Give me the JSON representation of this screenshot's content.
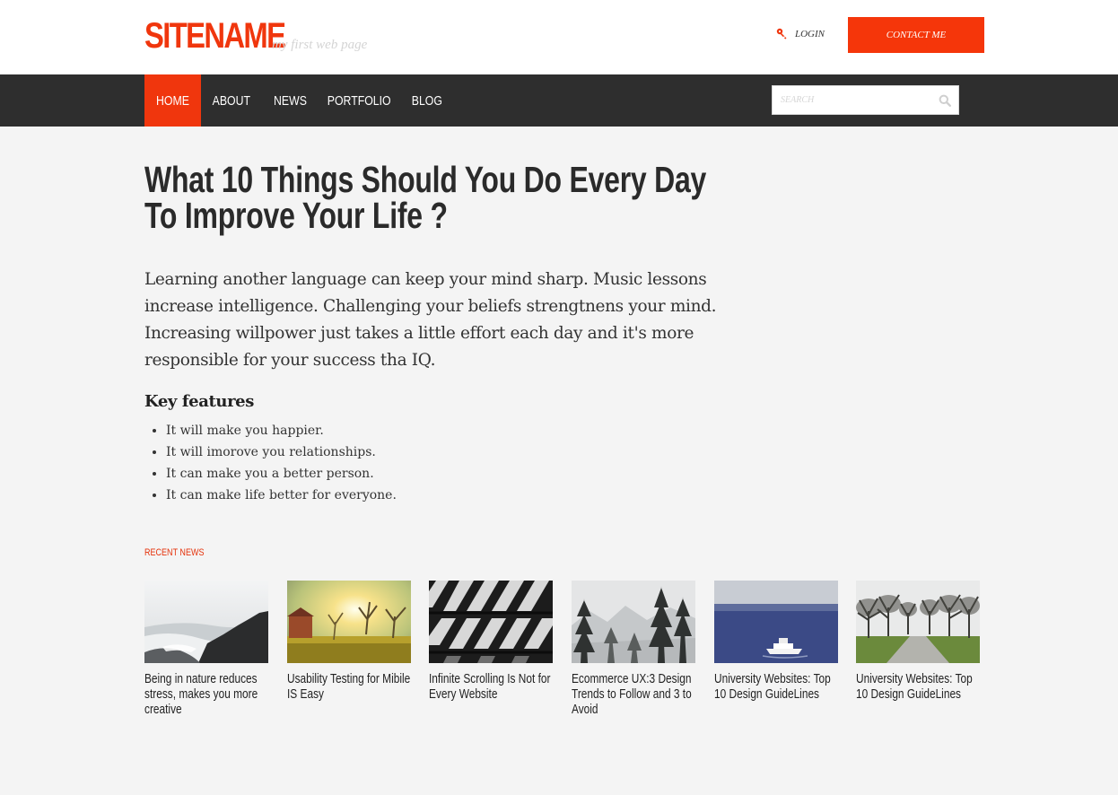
{
  "site": {
    "name": "SITENAME",
    "tagline": "my first web page",
    "login_label": "LOGIN",
    "contact_label": "CONTACT ME",
    "accent_color": "#f0360d"
  },
  "nav": {
    "items": [
      {
        "label": "HOME",
        "active": true
      },
      {
        "label": "ABOUT",
        "active": false
      },
      {
        "label": "NEWS",
        "active": false
      },
      {
        "label": "PORTFOLIO",
        "active": false
      },
      {
        "label": "BLOG",
        "active": false
      }
    ],
    "search_placeholder": "SEARCH"
  },
  "article": {
    "title_line1": "What 10 Things Should You Do Every Day",
    "title_line2": "To Improve Your Life ?",
    "intro": "Learning another language can keep your mind sharp. Music lessons increase intelligence. Challenging your beliefs strengtnens your mind. Increasing willpower just takes a little effort each day and it's more responsible for your success tha IQ.",
    "key_features_title": "Key features",
    "key_features": [
      "It will make you happier.",
      "It will imorove you relationships.",
      "It can make you a better person.",
      "It can make life better for everyone."
    ]
  },
  "recent_news": {
    "title": "RECENT NEWS",
    "items": [
      {
        "caption": "Being in nature reduces stress, makes you more creative",
        "thumb": "coast-rocks-photo"
      },
      {
        "caption": "Usability Testing for Mibile IS Easy",
        "thumb": "sunny-orchard-photo"
      },
      {
        "caption": "Infinite Scrolling Is Not for Every Website",
        "thumb": "building-facade-photo"
      },
      {
        "caption": "Ecommerce UX:3 Design Trends to Follow and 3 to Avoid",
        "thumb": "misty-forest-photo"
      },
      {
        "caption": "University Websites: Top 10 Design GuideLines",
        "thumb": "boat-on-sea-photo"
      },
      {
        "caption": "University Websites: Top 10 Design GuideLines",
        "thumb": "tree-lined-path-photo"
      }
    ]
  }
}
